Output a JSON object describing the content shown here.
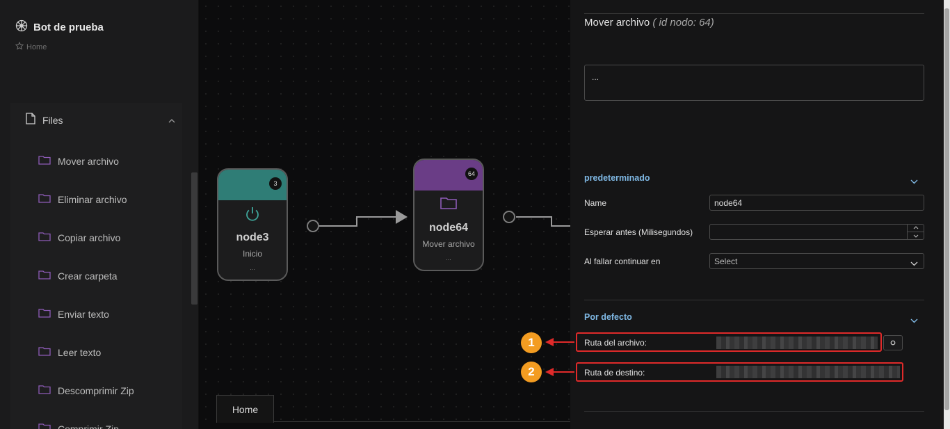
{
  "sidebar": {
    "bot_name": "Bot de prueba",
    "breadcrumb": "Home",
    "group_label": "Files",
    "items": [
      {
        "label": "Mover archivo"
      },
      {
        "label": "Eliminar archivo"
      },
      {
        "label": "Copiar archivo"
      },
      {
        "label": "Crear carpeta"
      },
      {
        "label": "Enviar texto"
      },
      {
        "label": "Leer texto"
      },
      {
        "label": "Descomprimir Zip"
      },
      {
        "label": "Comprimir Zip"
      }
    ]
  },
  "canvas": {
    "nodes": [
      {
        "badge": "3",
        "title": "node3",
        "subtitle": "Inicio",
        "dots": "...",
        "color": "#2f7d76"
      },
      {
        "badge": "64",
        "title": "node64",
        "subtitle": "Mover archivo",
        "dots": "...",
        "color": "#6a3d86"
      }
    ],
    "tab_label": "Home"
  },
  "panel": {
    "title": "Mover archivo",
    "title_meta": "( id nodo: 64)",
    "description": "...",
    "section1": "predeterminado",
    "fields": {
      "name_label": "Name",
      "name_value": "node64",
      "wait_label": "Esperar antes (Milisegundos)",
      "wait_value": "",
      "onfail_label": "Al fallar continuar en",
      "onfail_value": "Select"
    },
    "section2": "Por defecto",
    "source_label": "Ruta del archivo:",
    "dest_label": "Ruta de destino:"
  },
  "annotations": [
    {
      "number": "1"
    },
    {
      "number": "2"
    }
  ],
  "colors": {
    "accent_blue": "#7fb8e4",
    "highlight_red": "#e02a2a",
    "marker_orange": "#f39c21"
  }
}
